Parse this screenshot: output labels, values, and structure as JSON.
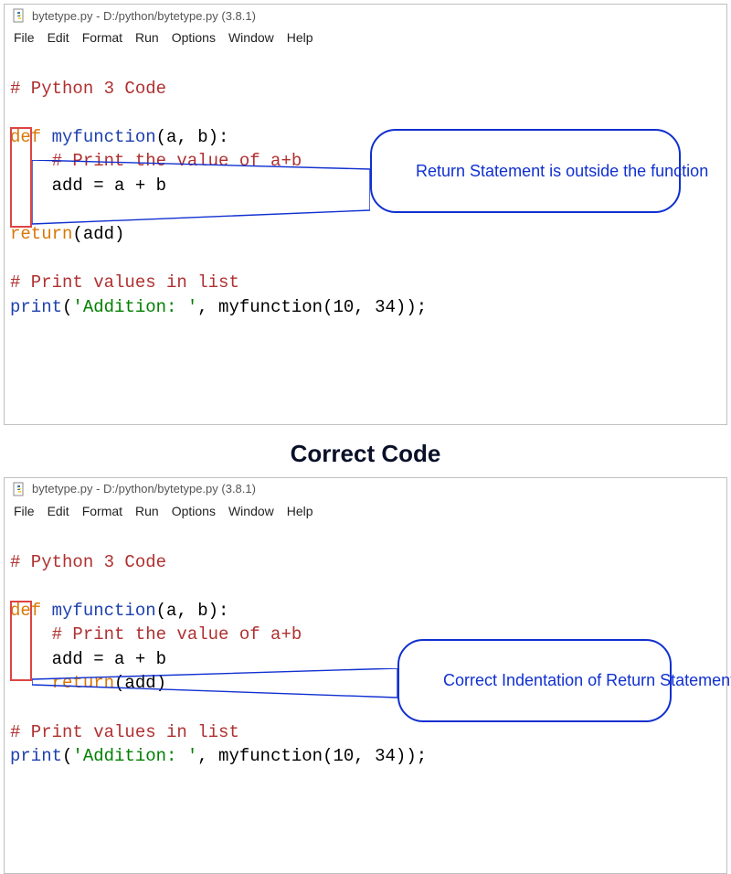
{
  "window": {
    "title": "bytetype.py - D:/python/bytetype.py (3.8.1)"
  },
  "menubar": {
    "items": [
      "File",
      "Edit",
      "Format",
      "Run",
      "Options",
      "Window",
      "Help"
    ]
  },
  "code_top": {
    "l1_comment": "# Python 3 Code",
    "l3_def": "def",
    "l3_func": " myfunction",
    "l3_args": "(a, b):",
    "l4_comment": "    # Print the value of a+b",
    "l5_assign": "    add = a + b",
    "l7_return": "return",
    "l7_paren": "(add)",
    "l9_comment": "# Print values in list",
    "l10_print": "print",
    "l10_open": "(",
    "l10_str": "'Addition: '",
    "l10_mid": ", myfunction(",
    "l10_n1": "10",
    "l10_c": ", ",
    "l10_n2": "34",
    "l10_end": "));"
  },
  "code_bottom": {
    "l1_comment": "# Python 3 Code",
    "l3_def": "def",
    "l3_func": " myfunction",
    "l3_args": "(a, b):",
    "l4_comment": "    # Print the value of a+b",
    "l5_assign": "    add = a + b",
    "l6_return": "    return",
    "l6_paren": "(add)",
    "l8_comment": "# Print values in list",
    "l9_print": "print",
    "l9_open": "(",
    "l9_str": "'Addition: '",
    "l9_mid": ", myfunction(",
    "l9_n1": "10",
    "l9_c": ", ",
    "l9_n2": "34",
    "l9_end": "));"
  },
  "callout_top": "Return Statement is outside the function",
  "callout_bottom": "Correct Indentation of Return Statement",
  "heading": "Correct Code"
}
